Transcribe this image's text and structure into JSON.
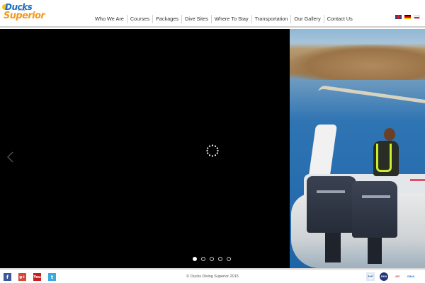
{
  "logo": {
    "line1": "Ducks",
    "line2": "diving",
    "line3": "Superior"
  },
  "nav": {
    "items": [
      "Who We Are",
      "Courses",
      "Packages",
      "Dive Sites",
      "Where To Stay",
      "Transportation",
      "Our Gallery",
      "Contact Us"
    ]
  },
  "languages": [
    "en-flag-icon",
    "de-flag-icon",
    "pl-flag-icon"
  ],
  "slider": {
    "total_slides": 5,
    "active_slide": 1,
    "photo_subject": "inflatable boat with twin outboard engines"
  },
  "footer": {
    "social": [
      "f",
      "g+",
      "You",
      "t"
    ],
    "copyright": "© Ducks Diving Superior 2015",
    "certifications": [
      "EUF",
      "PADI",
      "SSI",
      "CMAS"
    ]
  },
  "colors": {
    "logo_blue": "#1a6fc4",
    "logo_orange": "#f39a1e",
    "facebook": "#3b5998",
    "google_plus": "#d34836",
    "youtube": "#cc1d1d",
    "twitter": "#3aa9e0"
  }
}
